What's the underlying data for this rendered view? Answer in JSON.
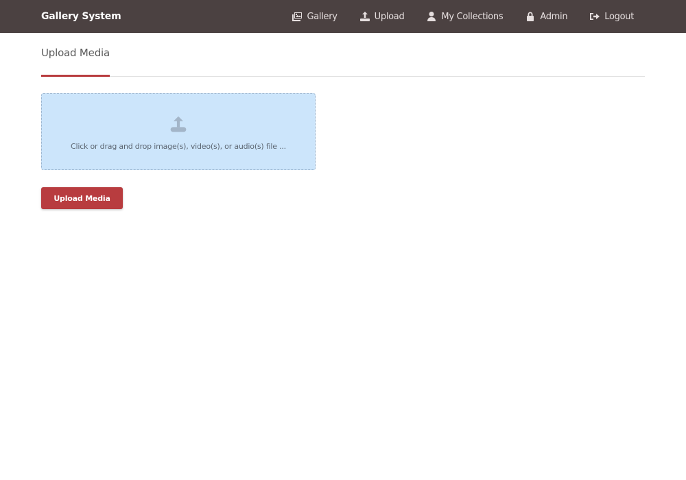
{
  "navbar": {
    "brand": "Gallery System",
    "items": [
      {
        "label": "Gallery",
        "icon": "images-icon"
      },
      {
        "label": "Upload",
        "icon": "upload-icon"
      },
      {
        "label": "My Collections",
        "icon": "user-icon"
      },
      {
        "label": "Admin",
        "icon": "lock-icon"
      },
      {
        "label": "Logout",
        "icon": "sign-out-icon"
      }
    ]
  },
  "page": {
    "tab_title": "Upload Media",
    "dropzone": {
      "icon": "upload-icon",
      "text": "Click or drag and drop image(s), video(s), or audio(s) file ..."
    },
    "upload_button_label": "Upload Media"
  },
  "colors": {
    "navbar_bg": "#4b4141",
    "accent": "#b83c3f",
    "dropzone_bg": "#cce5fb"
  }
}
